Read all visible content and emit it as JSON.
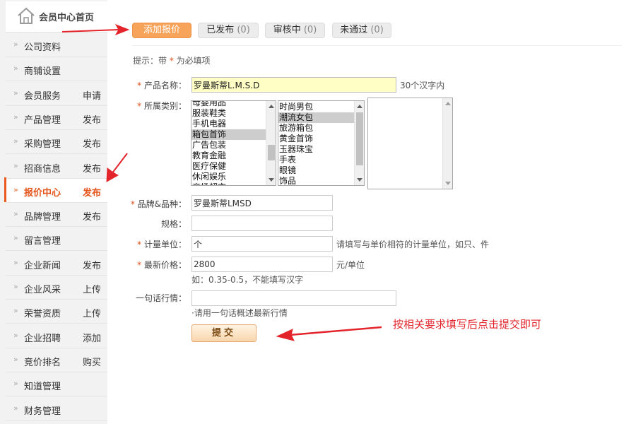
{
  "sidebar": {
    "home_label": "会员中心首页",
    "items": [
      {
        "label": "公司资料",
        "action": ""
      },
      {
        "label": "商铺设置",
        "action": ""
      },
      {
        "label": "会员服务",
        "action": "申请"
      },
      {
        "label": "产品管理",
        "action": "发布"
      },
      {
        "label": "采购管理",
        "action": "发布"
      },
      {
        "label": "招商信息",
        "action": "发布"
      },
      {
        "label": "报价中心",
        "action": "发布"
      },
      {
        "label": "品牌管理",
        "action": "发布"
      },
      {
        "label": "留言管理",
        "action": ""
      },
      {
        "label": "企业新闻",
        "action": "发布"
      },
      {
        "label": "企业风采",
        "action": "上传"
      },
      {
        "label": "荣誉资质",
        "action": "上传"
      },
      {
        "label": "企业招聘",
        "action": "添加"
      },
      {
        "label": "竞价排名",
        "action": "购买"
      },
      {
        "label": "知道管理",
        "action": ""
      },
      {
        "label": "财务管理",
        "action": ""
      }
    ]
  },
  "tabs": [
    {
      "label": "添加报价",
      "count": ""
    },
    {
      "label": "已发布",
      "count": "(0)"
    },
    {
      "label": "审核中",
      "count": "(0)"
    },
    {
      "label": "未通过",
      "count": "(0)"
    }
  ],
  "hint": {
    "prefix": "提示：带",
    "star": "*",
    "suffix": "为必填项"
  },
  "form": {
    "product_name": {
      "label": "产品名称：",
      "value": "罗曼斯蒂L.M.S.D",
      "note": "30个汉字内"
    },
    "category": {
      "label": "所属类别：",
      "list1": [
        "母婴用品",
        "服装鞋类",
        "手机电器",
        "箱包首饰",
        "广告包装",
        "教育金融",
        "医疗保健",
        "休闲娱乐",
        "商场超市"
      ],
      "list1_selected": "箱包首饰",
      "list2": [
        "时尚男包",
        "潮流女包",
        "旅游箱包",
        "黄金首饰",
        "玉器珠宝",
        "手表",
        "眼镜",
        "饰品"
      ],
      "list2_selected": "潮流女包"
    },
    "brand": {
      "label": "品牌&品种：",
      "value": "罗曼斯蒂LMSD"
    },
    "spec": {
      "label": "规格：",
      "value": ""
    },
    "unit": {
      "label": "计量单位：",
      "value": "个",
      "note": "请填写与单价相符的计量单位，如只、件"
    },
    "price": {
      "label": "最新价格：",
      "value": "2800",
      "unit_note": "元/单位",
      "example": "如：0.35-0.5，不能填写汉字"
    },
    "quote": {
      "label": "一句话行情：",
      "value": "",
      "note": "·请用一句话概述最新行情"
    },
    "submit_label": "提交"
  },
  "annotation": {
    "text": "按相关要求填写后点击提交即可",
    "color": "#e3242b"
  },
  "colors": {
    "accent": "#e4551b",
    "tab_active": "#f7a35a",
    "highlight_field": "#ffffc5"
  }
}
